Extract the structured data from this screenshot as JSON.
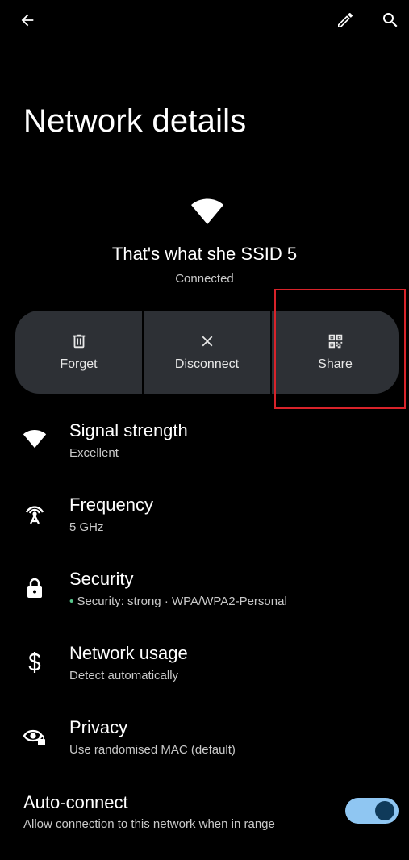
{
  "header": {
    "title": "Network details",
    "icons": {
      "back": "arrow-left-icon",
      "edit": "pencil-icon",
      "search": "search-icon"
    }
  },
  "network": {
    "ssid": "That's what she SSID 5",
    "status": "Connected"
  },
  "actions": [
    {
      "label": "Forget",
      "icon": "trash-icon"
    },
    {
      "label": "Disconnect",
      "icon": "close-icon"
    },
    {
      "label": "Share",
      "icon": "qr-code-icon"
    }
  ],
  "details": [
    {
      "title": "Signal strength",
      "subtitle": "Excellent",
      "icon": "wifi-icon"
    },
    {
      "title": "Frequency",
      "subtitle": "5 GHz",
      "icon": "antenna-icon"
    },
    {
      "title": "Security",
      "subtitle_dot": "•",
      "subtitle": "Security: strong · WPA/WPA2-Personal",
      "icon": "lock-icon"
    },
    {
      "title": "Network usage",
      "subtitle": "Detect automatically",
      "icon": "dollar-icon"
    },
    {
      "title": "Privacy",
      "subtitle": "Use randomised MAC (default)",
      "icon": "eye-lock-icon"
    }
  ],
  "auto_connect": {
    "title": "Auto-connect",
    "subtitle": "Allow connection to this network when in range",
    "enabled": true
  },
  "colors": {
    "background": "#000000",
    "action_bg": "#2d3035",
    "toggle_track": "#8fc6f2",
    "toggle_knob": "#0f3a5a",
    "highlight": "#d8232a",
    "security_dot": "#58c58b"
  }
}
